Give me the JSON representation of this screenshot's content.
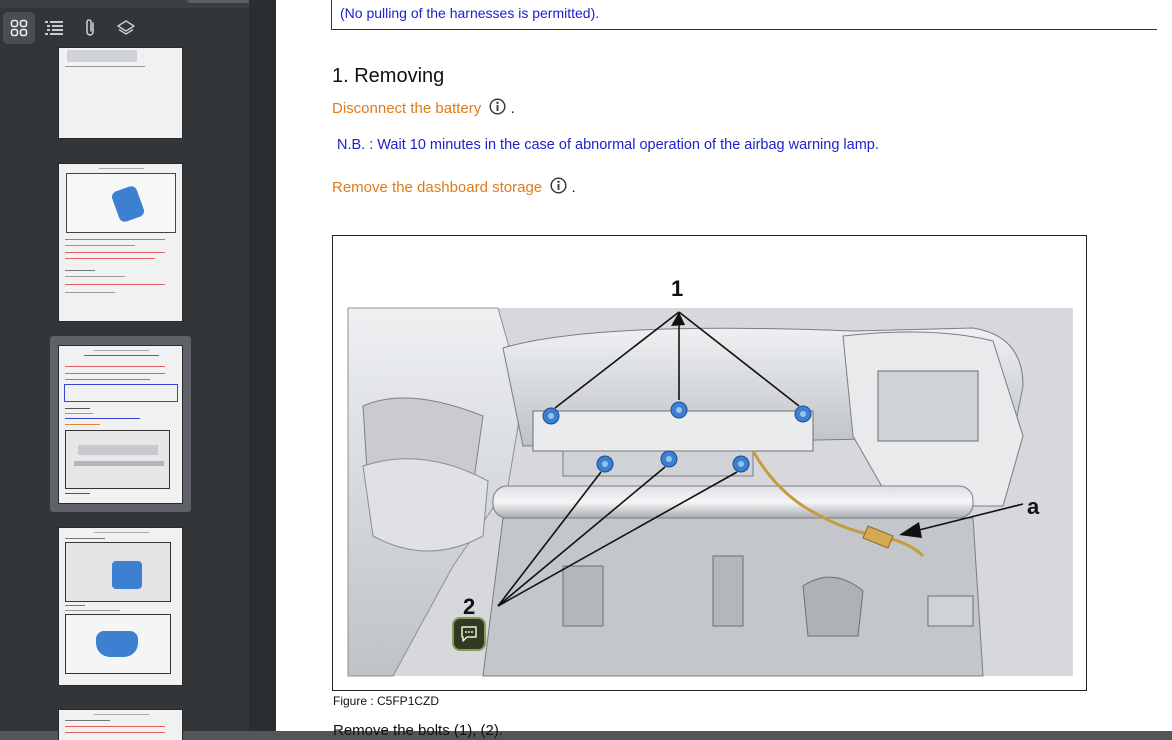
{
  "sidebar": {
    "toolbar": [
      {
        "name": "thumbnails-icon",
        "active": true
      },
      {
        "name": "outline-icon",
        "active": false
      },
      {
        "name": "attachments-icon",
        "active": false
      },
      {
        "name": "layers-icon",
        "active": false
      }
    ],
    "selected_page": 3,
    "page_count_visible": 5
  },
  "document": {
    "harness_note": "(No pulling of the harnesses is permitted).",
    "section_heading": "1. Removing",
    "step_disconnect_battery": "Disconnect the battery",
    "nb_note": "N.B. : Wait 10 minutes in the case of abnormal operation of the airbag warning lamp.",
    "step_remove_storage": "Remove the dashboard storage",
    "step_suffix": ".",
    "figure": {
      "callout_1": "1",
      "callout_2": "2",
      "callout_a": "a",
      "caption": "Figure : C5FP1CZD"
    },
    "next_step_cut": "Remove the bolts (1), (2)."
  },
  "colors": {
    "link_orange": "#e07b1a",
    "note_blue": "#1e22c8",
    "sidebar_bg": "#323639",
    "bolt_blue": "#3d7fd1"
  }
}
